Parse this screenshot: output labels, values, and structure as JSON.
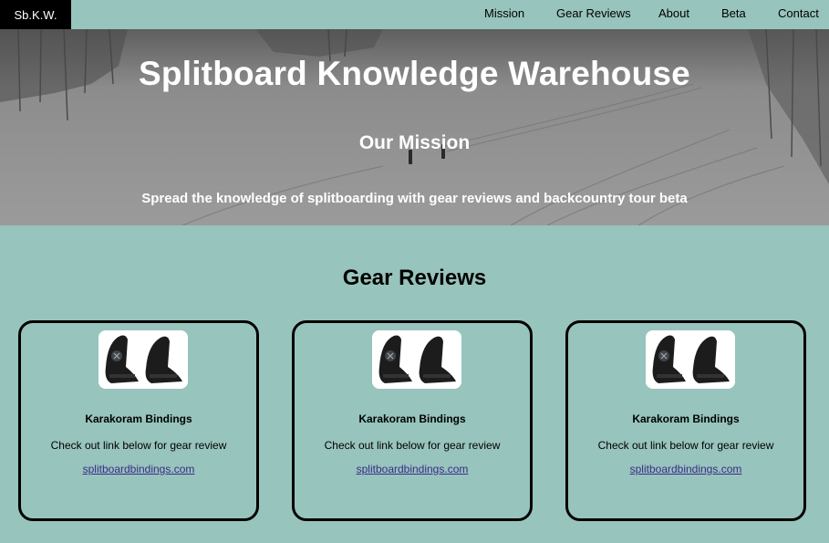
{
  "nav": {
    "brand": "Sb.K.W.",
    "links": [
      "Mission",
      "Gear Reviews",
      "About",
      "Beta",
      "Contact"
    ]
  },
  "hero": {
    "title": "Splitboard Knowledge Warehouse",
    "subtitle": "Our Mission",
    "tagline": "Spread the knowledge of splitboarding with gear reviews and backcountry tour beta"
  },
  "gear": {
    "title": "Gear Reviews",
    "cards": [
      {
        "name": "Karakoram Bindings",
        "description": "Check out link below for gear review",
        "link": "splitboardbindings.com"
      },
      {
        "name": "Karakoram Bindings",
        "description": "Check out link below for gear review",
        "link": "splitboardbindings.com"
      },
      {
        "name": "Karakoram Bindings",
        "description": "Check out link below for gear review",
        "link": "splitboardbindings.com"
      }
    ]
  },
  "colors": {
    "background": "#97c4bc",
    "brand_bg": "#000000",
    "link": "#3b2a8a"
  }
}
